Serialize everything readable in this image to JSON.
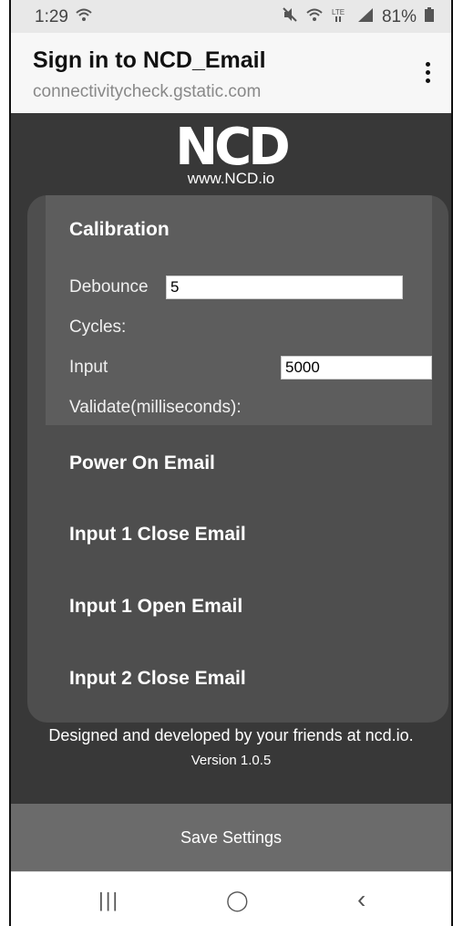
{
  "status": {
    "time": "1:29",
    "icons": [
      "mute-icon",
      "wifi-icon",
      "lte-icon",
      "signal-icon"
    ],
    "battery": "81%"
  },
  "browser": {
    "title": "Sign in to NCD_Email",
    "url": "connectivitycheck.gstatic.com",
    "menu_icon": "more-vert-icon"
  },
  "logo": {
    "mark": "NCD",
    "url": "www.NCD.io"
  },
  "calibration": {
    "title": "Calibration",
    "debounce_label": "Debounce",
    "debounce_value": "5",
    "cycles_label": "Cycles:",
    "input_label": "Input",
    "input_value": "5000",
    "validate_label": "Validate(milliseconds):"
  },
  "sections": {
    "power_on": "Power On Email",
    "input1_close": "Input 1 Close Email",
    "input1_open": "Input 1 Open Email",
    "input2_close": "Input 2 Close Email"
  },
  "footer": {
    "designed": "Designed and developed by your friends at ncd.io.",
    "version": "Version 1.0.5"
  },
  "save": {
    "label": "Save Settings"
  },
  "nav": {
    "recents": "|||",
    "home": "◯",
    "back": "‹"
  }
}
